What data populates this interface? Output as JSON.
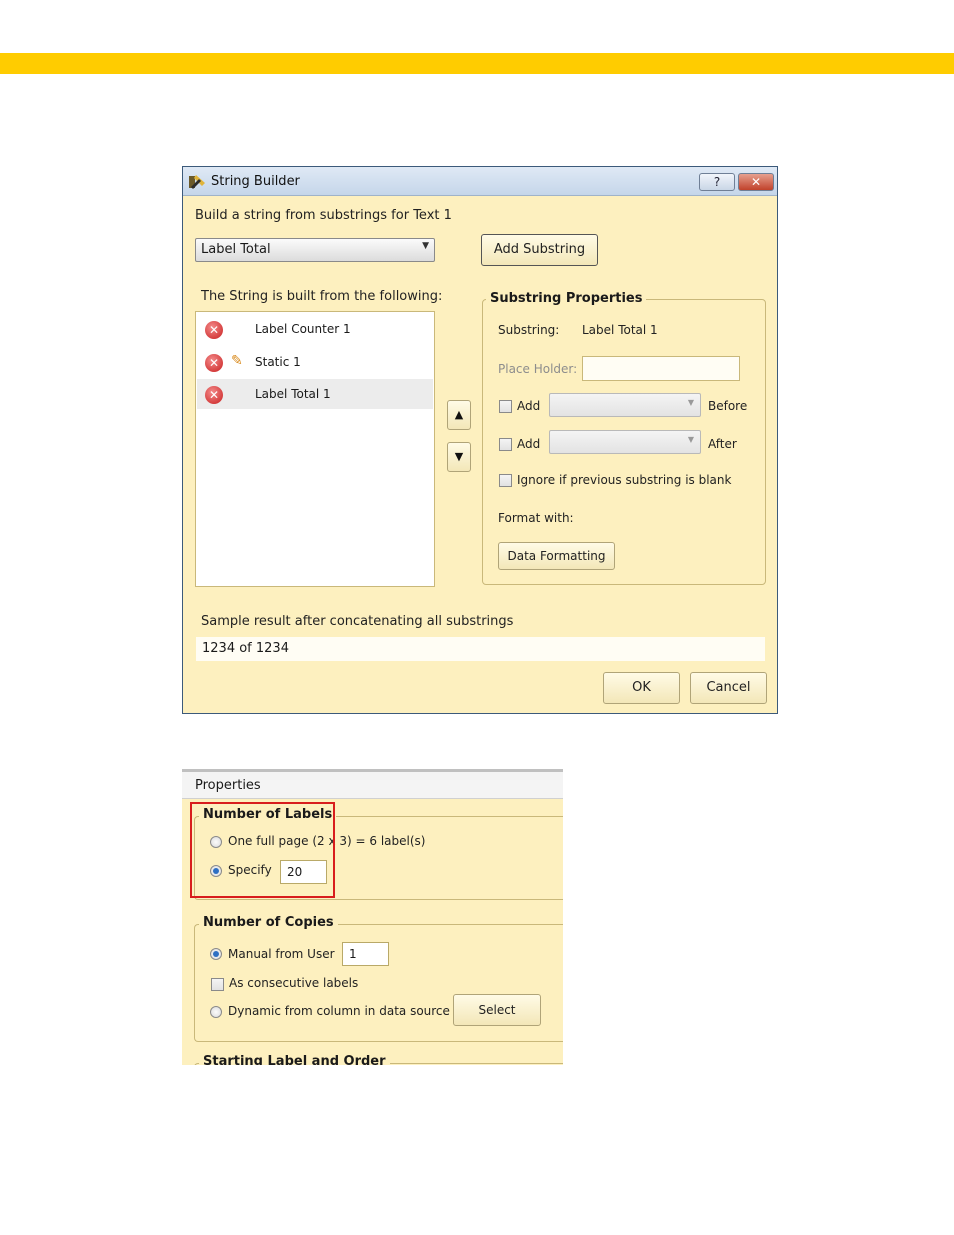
{
  "dialog": {
    "title": "String Builder",
    "help_button": "?",
    "close_button": "✕",
    "instruction": "Build a string from substrings for Text 1",
    "substring_type_selected": "Label Total",
    "add_substring_button": "Add Substring",
    "list_caption": "The String is built from the following:",
    "substrings": [
      {
        "label": "Label Counter 1",
        "editable": false,
        "selected": false
      },
      {
        "label": "Static 1",
        "editable": true,
        "selected": false
      },
      {
        "label": "Label Total 1",
        "editable": false,
        "selected": true
      }
    ],
    "move_up": "▲",
    "move_down": "▼",
    "substring_properties": {
      "title": "Substring Properties",
      "substring_label": "Substring:",
      "substring_value": "Label Total 1",
      "placeholder_label": "Place Holder:",
      "placeholder_value": "",
      "add_before_label": "Add",
      "before_label": "Before",
      "add_after_label": "Add",
      "after_label": "After",
      "ignore_blank_label": "Ignore if previous substring is blank",
      "format_with_label": "Format with:",
      "data_formatting_button": "Data Formatting"
    },
    "sample_caption": "Sample result after concatenating all substrings",
    "sample_value": "1234 of 1234",
    "ok_button": "OK",
    "cancel_button": "Cancel"
  },
  "properties": {
    "header": "Properties",
    "number_of_labels": {
      "title": "Number of Labels",
      "full_page_option": "One full page (2 x 3) = 6 label(s)",
      "specify_option": "Specify",
      "specify_value": "20",
      "selected": "specify"
    },
    "number_of_copies": {
      "title": "Number of Copies",
      "manual_option": "Manual from User",
      "manual_value": "1",
      "consecutive_label": "As consecutive labels",
      "dynamic_option": "Dynamic from column in data source",
      "select_button": "Select",
      "selected": "manual"
    },
    "next_group_title": "Starting Label and Order"
  },
  "colors": {
    "accent_band": "#ffcc00",
    "dialog_background": "#fdf0bf",
    "highlight_border": "#d81d1d"
  }
}
